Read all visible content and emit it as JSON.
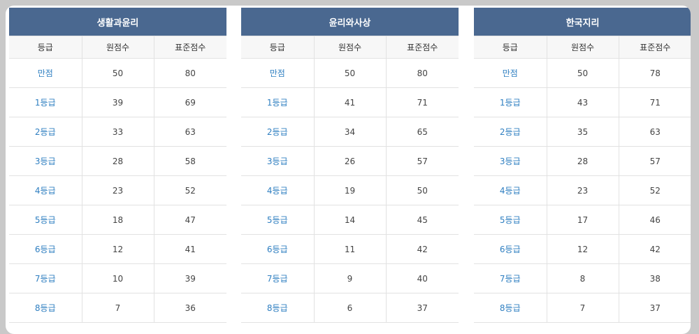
{
  "columns": [
    "등급",
    "원점수",
    "표준점수"
  ],
  "tables": [
    {
      "title": "생활과윤리",
      "rows": [
        {
          "grade": "만점",
          "raw": "50",
          "std": "80"
        },
        {
          "grade": "1등급",
          "raw": "39",
          "std": "69"
        },
        {
          "grade": "2등급",
          "raw": "33",
          "std": "63"
        },
        {
          "grade": "3등급",
          "raw": "28",
          "std": "58"
        },
        {
          "grade": "4등급",
          "raw": "23",
          "std": "52"
        },
        {
          "grade": "5등급",
          "raw": "18",
          "std": "47"
        },
        {
          "grade": "6등급",
          "raw": "12",
          "std": "41"
        },
        {
          "grade": "7등급",
          "raw": "10",
          "std": "39"
        },
        {
          "grade": "8등급",
          "raw": "7",
          "std": "36"
        }
      ]
    },
    {
      "title": "윤리와사상",
      "rows": [
        {
          "grade": "만점",
          "raw": "50",
          "std": "80"
        },
        {
          "grade": "1등급",
          "raw": "41",
          "std": "71"
        },
        {
          "grade": "2등급",
          "raw": "34",
          "std": "65"
        },
        {
          "grade": "3등급",
          "raw": "26",
          "std": "57"
        },
        {
          "grade": "4등급",
          "raw": "19",
          "std": "50"
        },
        {
          "grade": "5등급",
          "raw": "14",
          "std": "45"
        },
        {
          "grade": "6등급",
          "raw": "11",
          "std": "42"
        },
        {
          "grade": "7등급",
          "raw": "9",
          "std": "40"
        },
        {
          "grade": "8등급",
          "raw": "6",
          "std": "37"
        }
      ]
    },
    {
      "title": "한국지리",
      "rows": [
        {
          "grade": "만점",
          "raw": "50",
          "std": "78"
        },
        {
          "grade": "1등급",
          "raw": "43",
          "std": "71"
        },
        {
          "grade": "2등급",
          "raw": "35",
          "std": "63"
        },
        {
          "grade": "3등급",
          "raw": "28",
          "std": "57"
        },
        {
          "grade": "4등급",
          "raw": "23",
          "std": "52"
        },
        {
          "grade": "5등급",
          "raw": "17",
          "std": "46"
        },
        {
          "grade": "6등급",
          "raw": "12",
          "std": "42"
        },
        {
          "grade": "7등급",
          "raw": "8",
          "std": "38"
        },
        {
          "grade": "8등급",
          "raw": "7",
          "std": "37"
        }
      ]
    }
  ],
  "colors": {
    "header_bg": "#4a6890",
    "grade_text": "#2f7fc1",
    "page_bg": "#c9c9c9"
  }
}
